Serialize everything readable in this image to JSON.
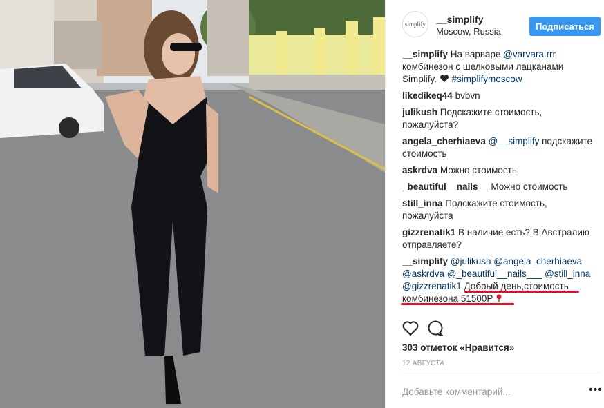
{
  "post": {
    "username": "__simplify",
    "location": "Moscow, Russia",
    "follow_label": "Подписаться",
    "logo_text": "simplify"
  },
  "comments": [
    {
      "user": "__simplify",
      "text": "На варваре",
      "mention": "@varvara.rrr",
      "text2": "комбинезон с шелковыми лацканами Simplify.",
      "tag": "#simplifymoscow"
    },
    {
      "user": "likedikeq44",
      "text": "bvbvn"
    },
    {
      "user": "julikush",
      "text": "Подскажите стоимость, пожалуйста?"
    },
    {
      "user": "angela_cherhiaeva",
      "mention": "@__simplify",
      "text": "подскажите стоимость"
    },
    {
      "user": "askrdva",
      "text": "Можно стоимость"
    },
    {
      "user": "_beautiful__nails__",
      "text": "Можно стоимость"
    },
    {
      "user": "still_inna",
      "text": "Подскажите стоимость, пожалуйста"
    },
    {
      "user": "gizzrenatik1",
      "text": "В наличие есть? В Австралию отправляете?"
    },
    {
      "user": "__simplify",
      "m1": "@julikush",
      "m2": "@angela_cherhiaeva",
      "m3": "@askrdva",
      "m4": "@_beautiful__nails___",
      "m5": "@still_inna",
      "m6": "@gizzrenatik1",
      "text": "Добрый день,стоимость комбинезона 51500Р"
    }
  ],
  "actions": {
    "like_icon": "heart-icon",
    "comment_icon": "comment-icon"
  },
  "likes_text": "303 отметок «Нравится»",
  "date_text": "12 АВГУСТА",
  "add_comment_placeholder": "Добавьте комментарий...",
  "more_label": "•••",
  "colors": {
    "accent": "#3897f0",
    "underline": "#e0102a",
    "mention": "#003569"
  }
}
